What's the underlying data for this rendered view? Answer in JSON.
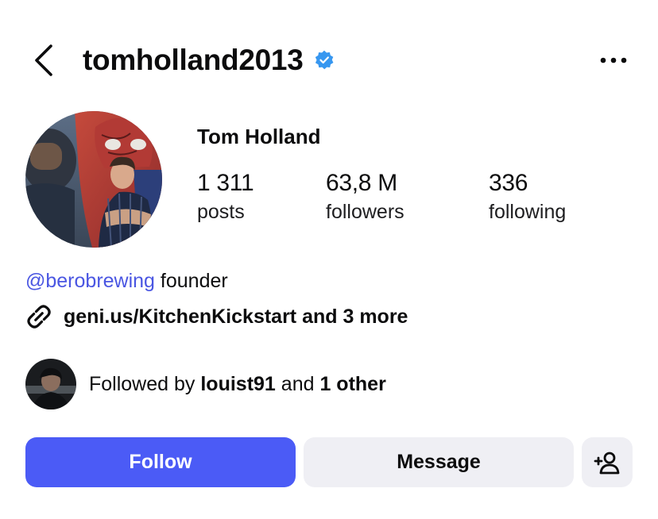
{
  "header": {
    "username": "tomholland2013",
    "verified": true,
    "icons": {
      "back": "chevron-left-icon",
      "verified": "verified-badge-icon",
      "more": "more-horizontal-icon"
    }
  },
  "profile": {
    "display_name": "Tom Holland",
    "stats": [
      {
        "value": "1 311",
        "label": "posts"
      },
      {
        "value": "63,8 M",
        "label": "followers"
      },
      {
        "value": "336",
        "label": "following"
      }
    ]
  },
  "bio": {
    "mention": "@berobrewing",
    "text": " founder",
    "link_text": "geni.us/KitchenKickstart and 3 more",
    "link_icon": "link-icon"
  },
  "followed_by": {
    "prefix": "Followed by ",
    "user": "louist91",
    "middle": " and ",
    "others": "1 other"
  },
  "actions": {
    "follow_label": "Follow",
    "message_label": "Message",
    "add_user_icon": "add-user-icon"
  },
  "colors": {
    "accent": "#4b5bf6",
    "mention": "#4a56e2",
    "verified": "#3797f0",
    "button_secondary": "#efeff4"
  }
}
